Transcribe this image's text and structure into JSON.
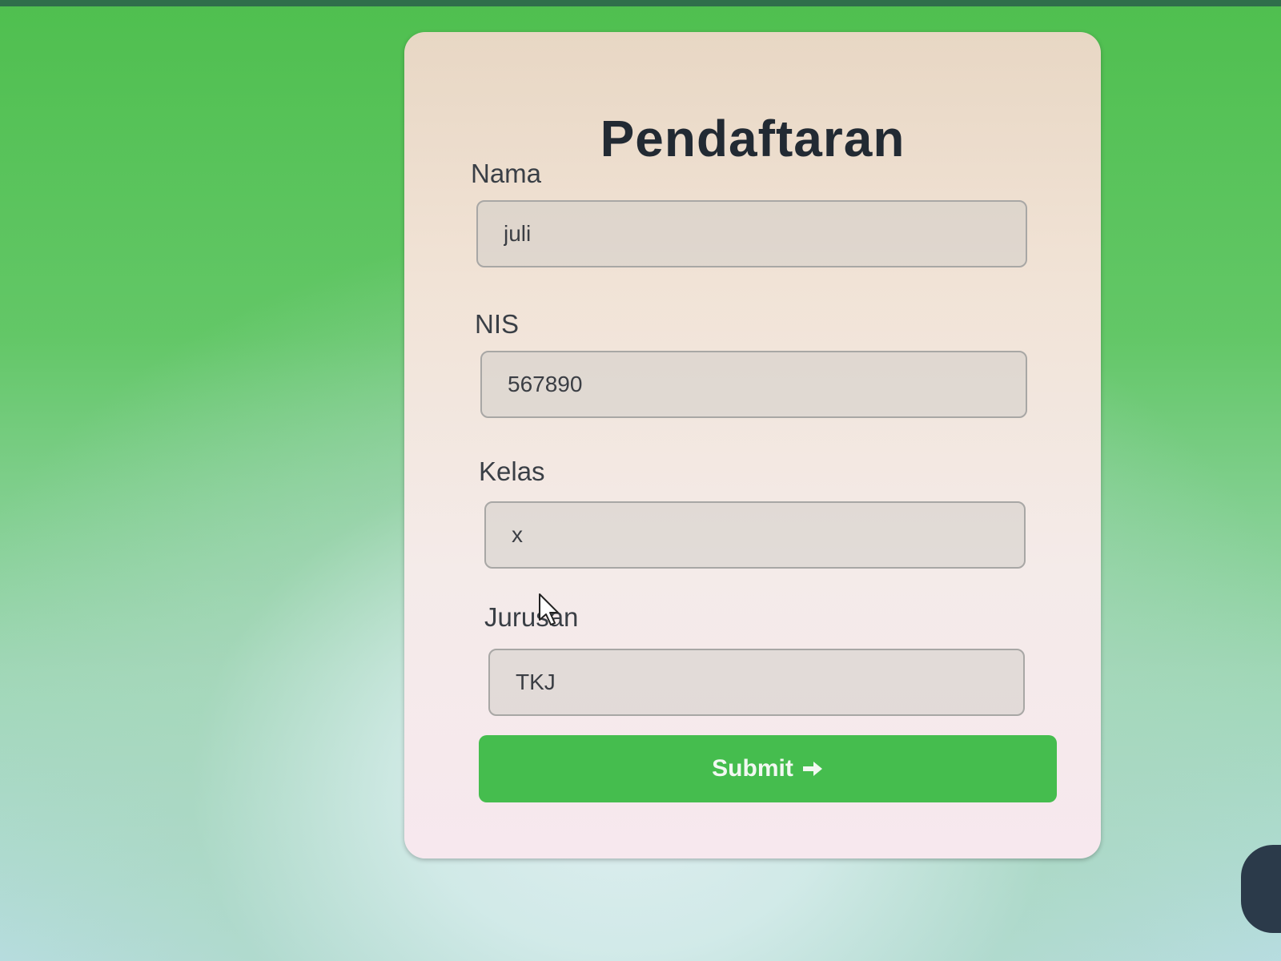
{
  "form": {
    "title": "Pendaftaran",
    "fields": [
      {
        "label": "Nama",
        "value": "juli"
      },
      {
        "label": "NIS",
        "value": "567890"
      },
      {
        "label": "Kelas",
        "value": "x"
      },
      {
        "label": "Jurusan",
        "value": "TKJ"
      }
    ],
    "submit_label": "Submit"
  },
  "colors": {
    "background_top": "#4fbf4f",
    "card": "#f1e3d6",
    "submit_button": "#45bd4e",
    "title_text": "#222a33"
  },
  "icons": {
    "submit": "arrow-right-icon",
    "cursor": "mouse-cursor-icon"
  }
}
